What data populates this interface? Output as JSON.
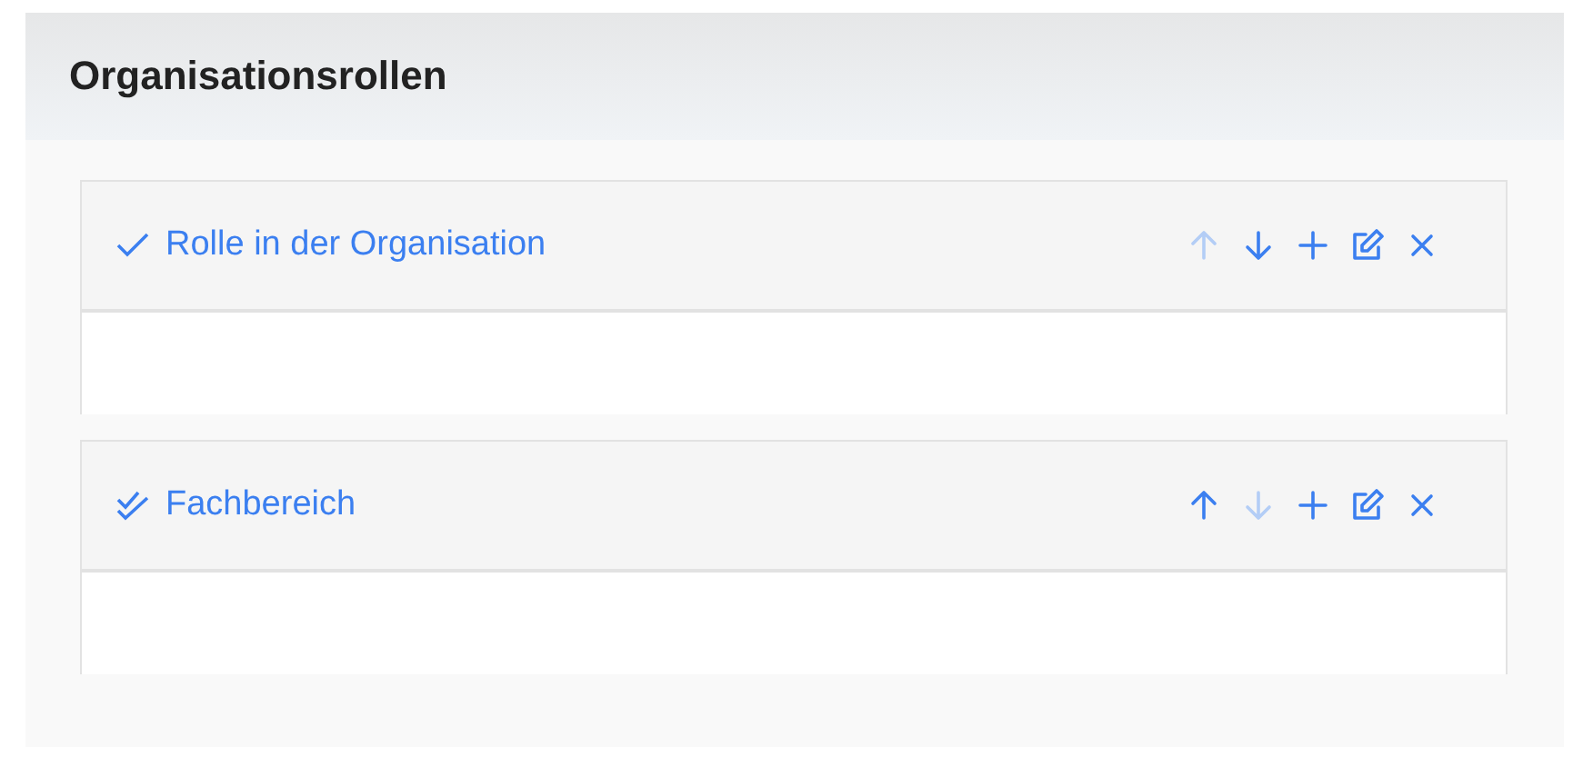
{
  "title": "Organisationsrollen",
  "cards": [
    {
      "kind": "single",
      "title": "Rolle in der Organisation",
      "up_disabled": true,
      "down_disabled": false
    },
    {
      "kind": "double",
      "title": "Fachbereich",
      "up_disabled": false,
      "down_disabled": true
    }
  ]
}
